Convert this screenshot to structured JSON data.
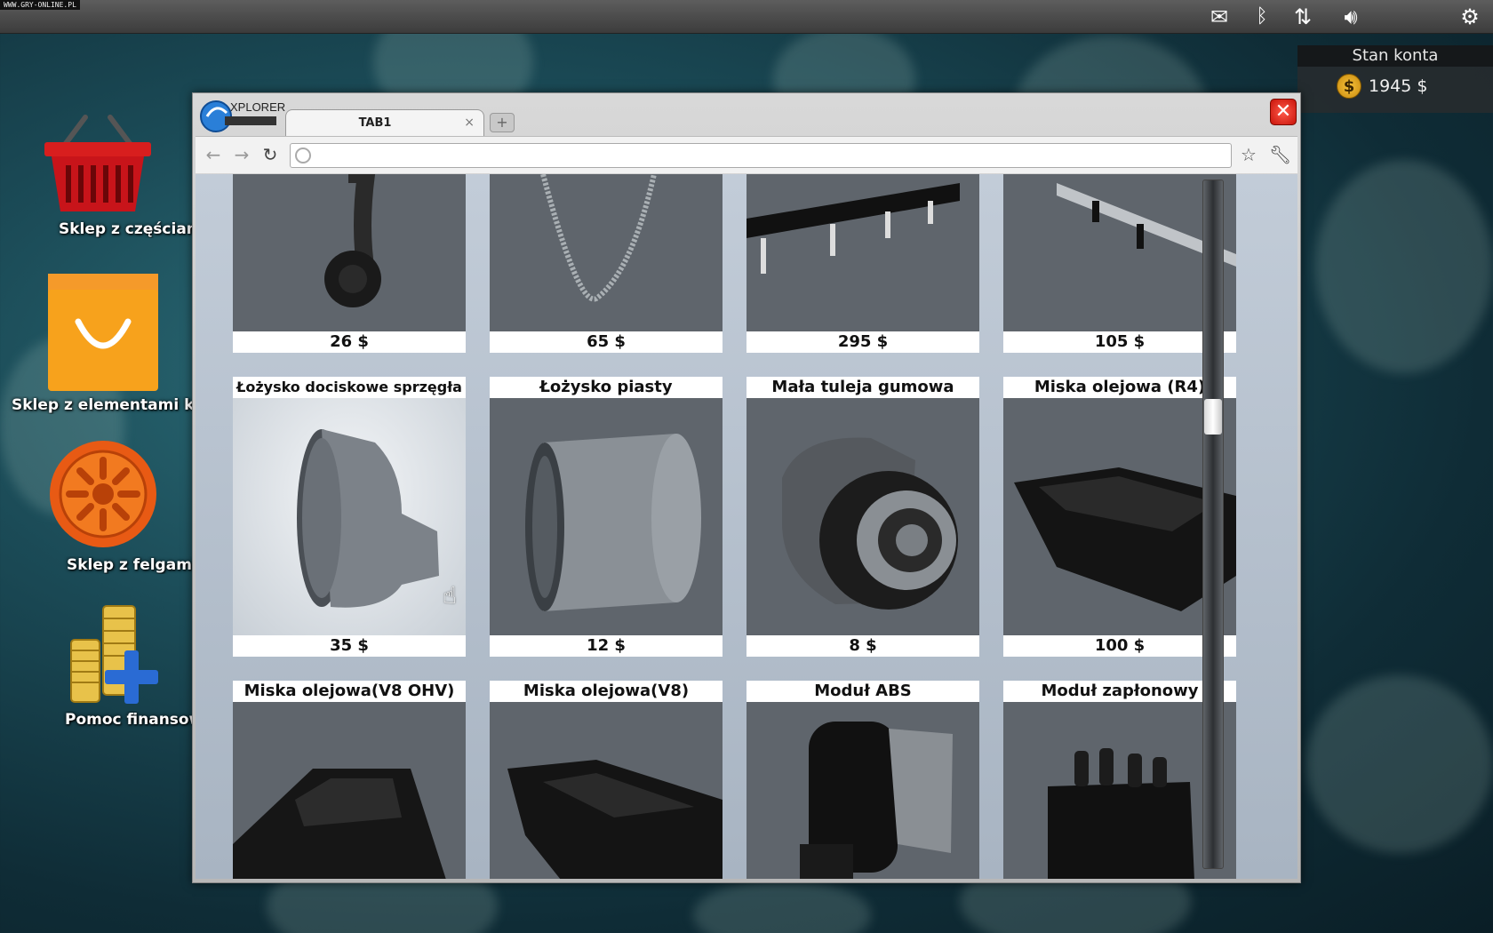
{
  "watermark": "WWW.GRY-ONLINE.PL",
  "tray": {
    "mail_icon": "envelope-icon",
    "bluetooth_icon": "bluetooth-icon",
    "network_icon": "updown-arrows-icon",
    "volume_icon": "speaker-icon",
    "power_icon": "power-icon"
  },
  "account": {
    "title": "Stan konta",
    "coin_symbol": "$",
    "balance": "1945 $"
  },
  "desktop": [
    {
      "label": "Sklep z częściami",
      "icon": "basket-icon"
    },
    {
      "label": "Sklep z elementami karoserii",
      "icon": "shopping-bag-icon"
    },
    {
      "label": "Sklep z felgami",
      "icon": "wheel-rim-icon"
    },
    {
      "label": "Pomoc finansowa",
      "icon": "coins-plus-icon"
    }
  ],
  "browser": {
    "logo_text": "XPLORER",
    "tab_label": "TAB1",
    "tab_close": "×",
    "new_tab": "+",
    "close_button": "✕",
    "address": ""
  },
  "products": {
    "row1": [
      {
        "price": "26 $"
      },
      {
        "price": "65 $"
      },
      {
        "price": "295 $"
      },
      {
        "price": "105 $"
      }
    ],
    "row2": [
      {
        "name": "Łożysko dociskowe sprzęgła",
        "price": "35 $"
      },
      {
        "name": "Łożysko piasty",
        "price": "12 $"
      },
      {
        "name": "Mała tuleja gumowa",
        "price": "8 $"
      },
      {
        "name": "Miska olejowa (R4)",
        "price": "100 $"
      }
    ],
    "row3": [
      {
        "name": "Miska olejowa(V8 OHV)"
      },
      {
        "name": "Miska olejowa(V8)"
      },
      {
        "name": "Moduł ABS"
      },
      {
        "name": "Moduł zapłonowy"
      }
    ]
  }
}
